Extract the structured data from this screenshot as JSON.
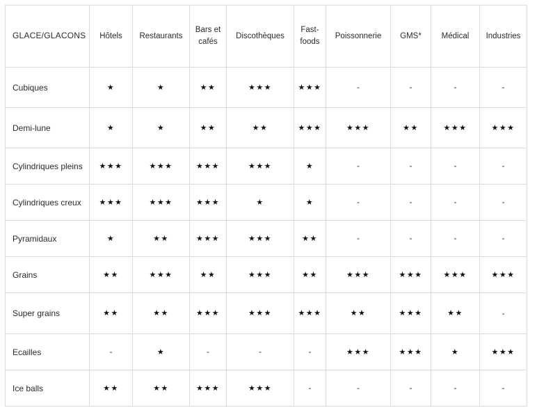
{
  "table": {
    "corner_label": "GLACE/GLACONS",
    "columns": [
      "Hôtels",
      "Restaurants",
      "Bars et cafés",
      "Discothèques",
      "Fast-foods",
      "Poissonnerie",
      "GMS*",
      "Médical",
      "Industries"
    ],
    "empty_marker": "-",
    "star_glyph": "★",
    "rows": [
      {
        "label": "Cubiques",
        "ratings": [
          1,
          1,
          2,
          3,
          3,
          0,
          0,
          0,
          0
        ],
        "cells": [
          "★",
          "★",
          "★★",
          "★★★",
          "★★★",
          "-",
          "-",
          "-",
          "-"
        ]
      },
      {
        "label": "Demi-lune",
        "ratings": [
          1,
          1,
          2,
          2,
          3,
          3,
          2,
          3,
          3
        ],
        "cells": [
          "★",
          "★",
          "★★",
          "★★",
          "★★★",
          "★★★",
          "★★",
          "★★★",
          "★★★"
        ]
      },
      {
        "label": "Cylindriques pleins",
        "ratings": [
          3,
          3,
          3,
          3,
          1,
          0,
          0,
          0,
          0
        ],
        "cells": [
          "★★★",
          "★★★",
          "★★★",
          "★★★",
          "★",
          "-",
          "-",
          "-",
          "-"
        ]
      },
      {
        "label": "Cylindriques creux",
        "ratings": [
          3,
          3,
          3,
          1,
          1,
          0,
          0,
          0,
          0
        ],
        "cells": [
          "★★★",
          "★★★",
          "★★★",
          "★",
          "★",
          "-",
          "-",
          "-",
          "-"
        ]
      },
      {
        "label": "Pyramidaux",
        "ratings": [
          1,
          2,
          3,
          3,
          2,
          0,
          0,
          0,
          0
        ],
        "cells": [
          "★",
          "★★",
          "★★★",
          "★★★",
          "★★",
          "-",
          "-",
          "-",
          "-"
        ]
      },
      {
        "label": "Grains",
        "ratings": [
          2,
          3,
          2,
          3,
          2,
          3,
          3,
          3,
          3
        ],
        "cells": [
          "★★",
          "★★★",
          "★★",
          "★★★",
          "★★",
          "★★★",
          "★★★",
          "★★★",
          "★★★"
        ]
      },
      {
        "label": "Super grains",
        "ratings": [
          2,
          2,
          3,
          3,
          3,
          2,
          3,
          2,
          0
        ],
        "cells": [
          "★★",
          "★★",
          "★★★",
          "★★★",
          "★★★",
          "★★",
          "★★★",
          "★★",
          "-"
        ]
      },
      {
        "label": "Ecailles",
        "ratings": [
          0,
          1,
          0,
          0,
          0,
          3,
          3,
          1,
          3
        ],
        "cells": [
          "-",
          "★",
          "-",
          "-",
          "-",
          "★★★",
          "★★★",
          "★",
          "★★★"
        ]
      },
      {
        "label": "Ice balls",
        "ratings": [
          2,
          2,
          3,
          3,
          0,
          0,
          0,
          0,
          0
        ],
        "cells": [
          "★★",
          "★★",
          "★★★",
          "★★★",
          "-",
          "-",
          "-",
          "-",
          "-"
        ]
      }
    ]
  },
  "colors": {
    "border": "#dcdcdc",
    "text": "#2b2b2b",
    "star": "#111111",
    "background": "#ffffff"
  }
}
